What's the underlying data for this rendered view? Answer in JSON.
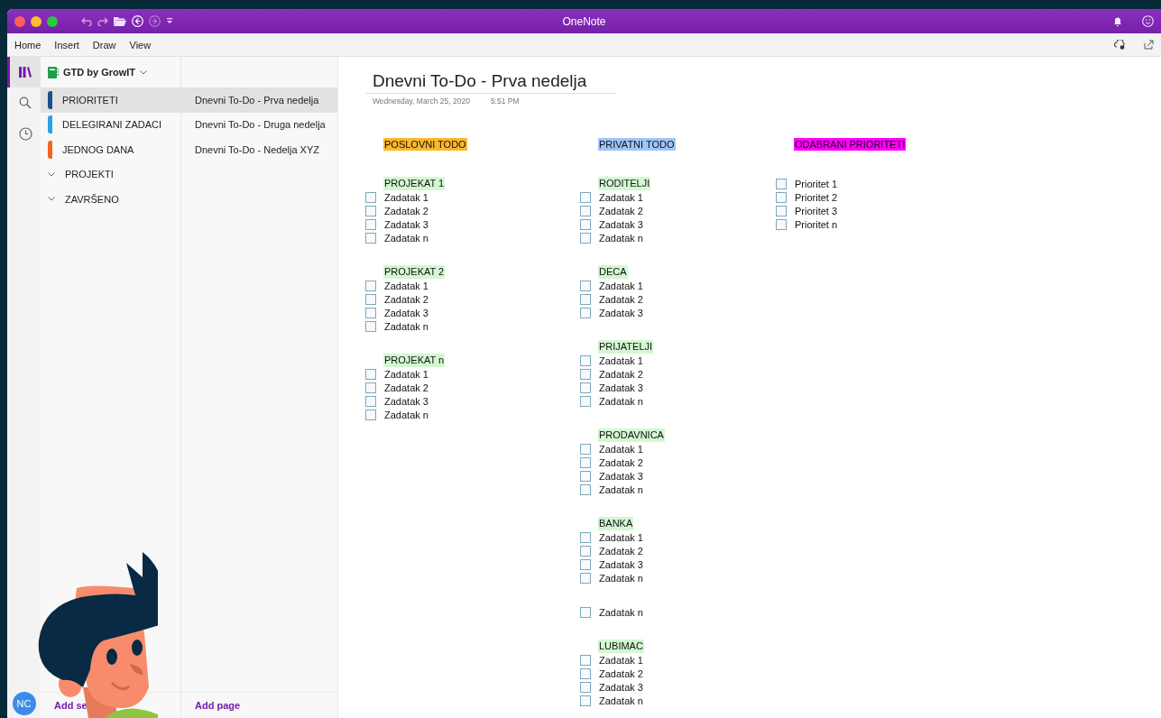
{
  "window": {
    "title": "OneNote"
  },
  "menu": [
    {
      "label": "Home"
    },
    {
      "label": "Insert"
    },
    {
      "label": "Draw"
    },
    {
      "label": "View"
    }
  ],
  "rail": [
    {
      "kind": "library",
      "selected": true
    },
    {
      "kind": "search",
      "selected": false
    },
    {
      "kind": "recent",
      "selected": false
    }
  ],
  "user": {
    "initials": "NC"
  },
  "notebook": {
    "name": "GTD by GrowIT"
  },
  "sections": [
    {
      "kind": "section",
      "label": "PRIORITETI",
      "color": "#1f4e8c",
      "selected": true
    },
    {
      "kind": "section",
      "label": "DELEGIRANI ZADACI",
      "color": "#2b9fe0",
      "selected": false
    },
    {
      "kind": "section",
      "label": "JEDNOG DANA",
      "color": "#f26522",
      "selected": false
    },
    {
      "kind": "group",
      "label": "PROJEKTI",
      "selected": false
    },
    {
      "kind": "group",
      "label": "ZAVRŠENO",
      "selected": false
    }
  ],
  "pages": [
    {
      "label": "Dnevni To-Do - Prva nedelja",
      "selected": true
    },
    {
      "label": "Dnevni To-Do - Druga nedelja",
      "selected": false
    },
    {
      "label": "Dnevni To-Do - Nedelja XYZ",
      "selected": false
    }
  ],
  "add_section": {
    "label": "Add se"
  },
  "add_page": {
    "label": "Add page"
  },
  "note": {
    "title": "Dnevni To-Do - Prva nedelja",
    "date": "Wednesday, March 25, 2020",
    "time": "5:51 PM",
    "columns": [
      {
        "heading": "POSLOVNI TODO",
        "color": "#fbb829",
        "groups": [
          {
            "heading": "PROJEKAT 1",
            "items": [
              {
                "text": "Zadatak 1",
                "checked": false
              },
              {
                "text": "Zadatak 2",
                "checked": false
              },
              {
                "text": "Zadatak 3",
                "checked": false
              },
              {
                "text": "Zadatak n",
                "checked": false
              }
            ]
          },
          {
            "heading": "PROJEKAT 2",
            "items": [
              {
                "text": "Zadatak 1",
                "checked": false
              },
              {
                "text": "Zadatak 2",
                "checked": false
              },
              {
                "text": "Zadatak 3",
                "checked": false
              },
              {
                "text": "Zadatak n",
                "checked": false
              }
            ]
          },
          {
            "heading": "PROJEKAT n",
            "items": [
              {
                "text": "Zadatak 1",
                "checked": false
              },
              {
                "text": "Zadatak 2",
                "checked": false
              },
              {
                "text": "Zadatak 3",
                "checked": false
              },
              {
                "text": "Zadatak n",
                "checked": false
              }
            ]
          }
        ]
      },
      {
        "heading": "PRIVATNI TODO",
        "color": "#9fc5f8",
        "groups": [
          {
            "heading": "RODITELJI",
            "items": [
              {
                "text": "Zadatak 1",
                "checked": false
              },
              {
                "text": "Zadatak 2",
                "checked": false
              },
              {
                "text": "Zadatak 3",
                "checked": false
              },
              {
                "text": "Zadatak n",
                "checked": false
              }
            ]
          },
          {
            "heading": "DECA",
            "items": [
              {
                "text": "Zadatak 1",
                "checked": false
              },
              {
                "text": "Zadatak 2",
                "checked": false
              },
              {
                "text": "Zadatak 3",
                "checked": false
              }
            ]
          },
          {
            "heading": "PRIJATELJI",
            "items": [
              {
                "text": "Zadatak 1",
                "checked": false
              },
              {
                "text": "Zadatak 2",
                "checked": false
              },
              {
                "text": "Zadatak 3",
                "checked": false
              },
              {
                "text": "Zadatak n",
                "checked": false
              }
            ]
          },
          {
            "heading": "PRODAVNICA",
            "items": [
              {
                "text": "Zadatak 1",
                "checked": false
              },
              {
                "text": "Zadatak 2",
                "checked": false
              },
              {
                "text": "Zadatak 3",
                "checked": false
              },
              {
                "text": "Zadatak n",
                "checked": false
              }
            ]
          },
          {
            "heading": "BANKA",
            "items": [
              {
                "text": "Zadatak 1",
                "checked": false
              },
              {
                "text": "Zadatak 2",
                "checked": false
              },
              {
                "text": "Zadatak 3",
                "checked": false
              },
              {
                "text": "Zadatak n",
                "checked": false
              }
            ]
          },
          {
            "items": [
              {
                "text": "Zadatak n",
                "checked": false
              }
            ]
          },
          {
            "heading": "LUBIMAC",
            "items": [
              {
                "text": "Zadatak 1",
                "checked": false
              },
              {
                "text": "Zadatak 2",
                "checked": false
              },
              {
                "text": "Zadatak 3",
                "checked": false
              },
              {
                "text": "Zadatak n",
                "checked": false
              }
            ]
          }
        ]
      },
      {
        "heading": "ODABRANI PRIORITETI",
        "color": "#ff00ff",
        "groups": [
          {
            "items": [
              {
                "text": "Prioritet 1",
                "checked": false
              },
              {
                "text": "Prioritet 2",
                "checked": false
              },
              {
                "text": "Prioritet 3",
                "checked": false
              },
              {
                "text": "Prioritet n",
                "checked": false
              }
            ]
          }
        ]
      }
    ]
  }
}
